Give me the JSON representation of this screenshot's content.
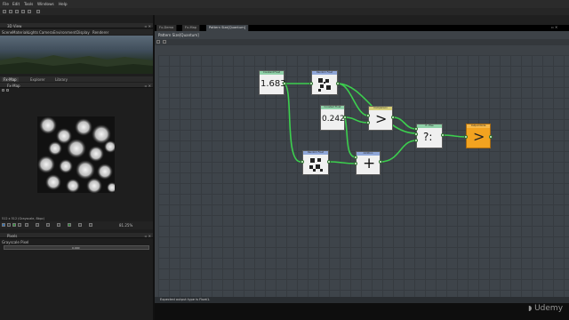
{
  "menubar": {
    "items": [
      "File",
      "Edit",
      "Tools",
      "Windows",
      "Help"
    ]
  },
  "view3d": {
    "title": "3D View",
    "menu": [
      "Scene",
      "Materials",
      "Lights",
      "Camera",
      "Environment",
      "Display",
      "Renderer"
    ]
  },
  "tabs2d": [
    "Fx-Map",
    "Explorer",
    "Library"
  ],
  "map2d": {
    "title": "Fx-Map",
    "info": "512 x 512 (Grayscale, 8bpc)",
    "zoom": "81.25%"
  },
  "pixels": {
    "title": "Pixels",
    "item": "Grayscale Pixel",
    "value_label": "0.000"
  },
  "editor": {
    "tabs": [
      "Fx-Demo",
      "Fx-Map",
      "Pattern Size[Quantum]"
    ],
    "breadcrumb": "Pattern Size[Quantum]",
    "status": "Expected output type is Float1."
  },
  "nodes": {
    "const1": {
      "header": "Constant Float",
      "value": "1.683"
    },
    "var1": {
      "header": "Random Float"
    },
    "const2": {
      "header": "Constant Float",
      "value": "0.242"
    },
    "greater": {
      "header": "Comparison",
      "symbol": ">"
    },
    "ifelse": {
      "header": "If...Else",
      "symbol": "?:"
    },
    "var2": {
      "header": "Random Float"
    },
    "add": {
      "header": "Addition",
      "symbol": "+"
    },
    "output": {
      "header": "Output Node",
      "symbol": ">"
    }
  },
  "colors": {
    "header_green": "#8fd0a8",
    "header_blue": "#8fa6d8",
    "header_yellow": "#d6cf7a",
    "output_orange": "#f2a320",
    "wire": "#3ccf4e"
  },
  "watermark": "Udemy"
}
